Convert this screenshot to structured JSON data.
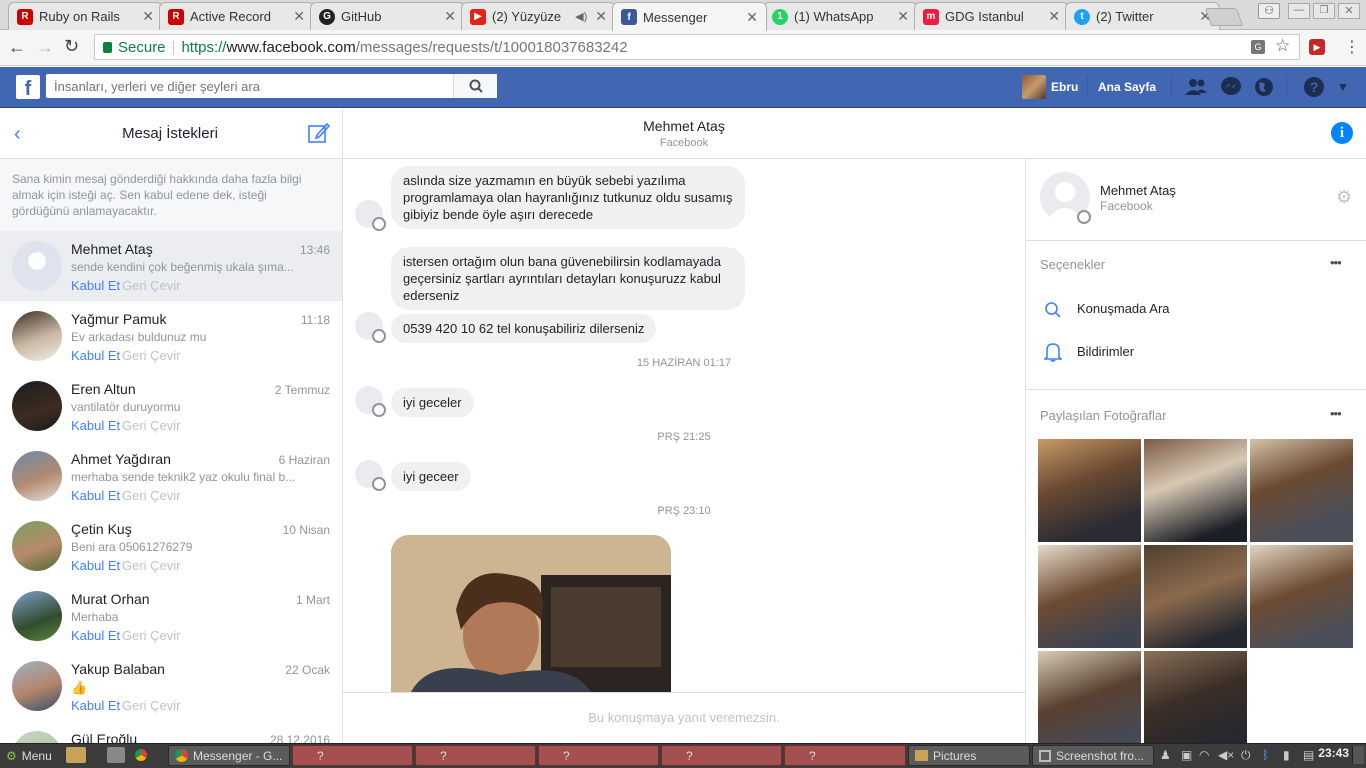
{
  "tabs": [
    {
      "title": "Ruby on Rails",
      "color": "#cc0000",
      "glyph": "R"
    },
    {
      "title": "Active Record",
      "color": "#cc0000",
      "glyph": "R"
    },
    {
      "title": "GitHub",
      "color": "#222222",
      "glyph": "G"
    },
    {
      "title": "(2) Yüzyüze",
      "color": "#e62117",
      "glyph": "▶"
    },
    {
      "title": "Messenger",
      "color": "#3b5998",
      "glyph": "f"
    },
    {
      "title": "(1) WhatsApp",
      "color": "#25d366",
      "glyph": "1"
    },
    {
      "title": "GDG Istanbul",
      "color": "#ed1c40",
      "glyph": "m"
    },
    {
      "title": "(2) Twitter",
      "color": "#1da1f2",
      "glyph": "t"
    }
  ],
  "address": {
    "secure": "Secure",
    "protocol": "https://",
    "domain": "www.facebook.com",
    "path": "/messages/requests/t/100018037683242"
  },
  "fb": {
    "search_placeholder": "İnsanları, yerleri ve diğer şeyleri ara",
    "user": "Ebru",
    "home": "Ana Sayfa"
  },
  "left": {
    "title": "Mesaj İstekleri",
    "info": "Sana kimin mesaj gönderdiği hakkında daha fazla bilgi almak için isteği aç. Sen kabul edene dek, isteği gördüğünü anlamayacaktır.",
    "accept": "Kabul Et",
    "decline": "Geri Çevir",
    "conversations": [
      {
        "name": "Mehmet Ataş",
        "time": "13:46",
        "snippet": "sende kendini çok beğenmiş ukala şıma..."
      },
      {
        "name": "Yağmur Pamuk",
        "time": "11:18",
        "snippet": "Ev arkadası buldunuz mu"
      },
      {
        "name": "Eren Altun",
        "time": "2 Temmuz",
        "snippet": "vantilatör duruyormu"
      },
      {
        "name": "Ahmet Yağdıran",
        "time": "6 Haziran",
        "snippet": "merhaba sende teknik2 yaz okulu final b..."
      },
      {
        "name": "Çetin Kuş",
        "time": "10 Nisan",
        "snippet": "Beni ara 05061276279"
      },
      {
        "name": "Murat Orhan",
        "time": "1 Mart",
        "snippet": "Merhaba"
      },
      {
        "name": "Yakup Balaban",
        "time": "22 Ocak",
        "snippet": ""
      },
      {
        "name": "Gül Eroğlu",
        "time": "28.12.2016",
        "snippet": ""
      }
    ]
  },
  "chat": {
    "name": "Mehmet Ataş",
    "sub": "Facebook",
    "messages": [
      "aslında size yazmamın en büyük sebebi yazılıma programlamaya olan hayranlığınız tutkunuz oldu susamış gibiyiz bende öyle aşırı derecede",
      "istersen ortağım olun bana güvenebilirsin kodlamayada geçersiniz   şartları ayrıntıları detayları konuşuruzz kabul ederseniz",
      "0539 420 10 62 tel konuşabiliriz dilerseniz",
      "iyi geceler",
      "iyi geceer"
    ],
    "stamps": [
      "15 HAZİRAN 01:17",
      "PRŞ 21:25",
      "PRŞ 23:10"
    ],
    "footer": "Bu konuşmaya yanıt veremezsin."
  },
  "side": {
    "name": "Mehmet Ataş",
    "sub": "Facebook",
    "options_title": "Seçenekler",
    "search_conv": "Konuşmada Ara",
    "notifications": "Bildirimler",
    "photos_title": "Paylaşılan Fotoğraflar",
    "more": "•••"
  },
  "taskbar": {
    "menu": "Menu",
    "messenger": "Messenger - G...",
    "unknown": "?",
    "pictures": "Pictures",
    "screenshot": "Screenshot fro...",
    "clock": "23:43"
  },
  "colors": {
    "fb_blue": "#4267b2",
    "link": "#4080ff"
  }
}
